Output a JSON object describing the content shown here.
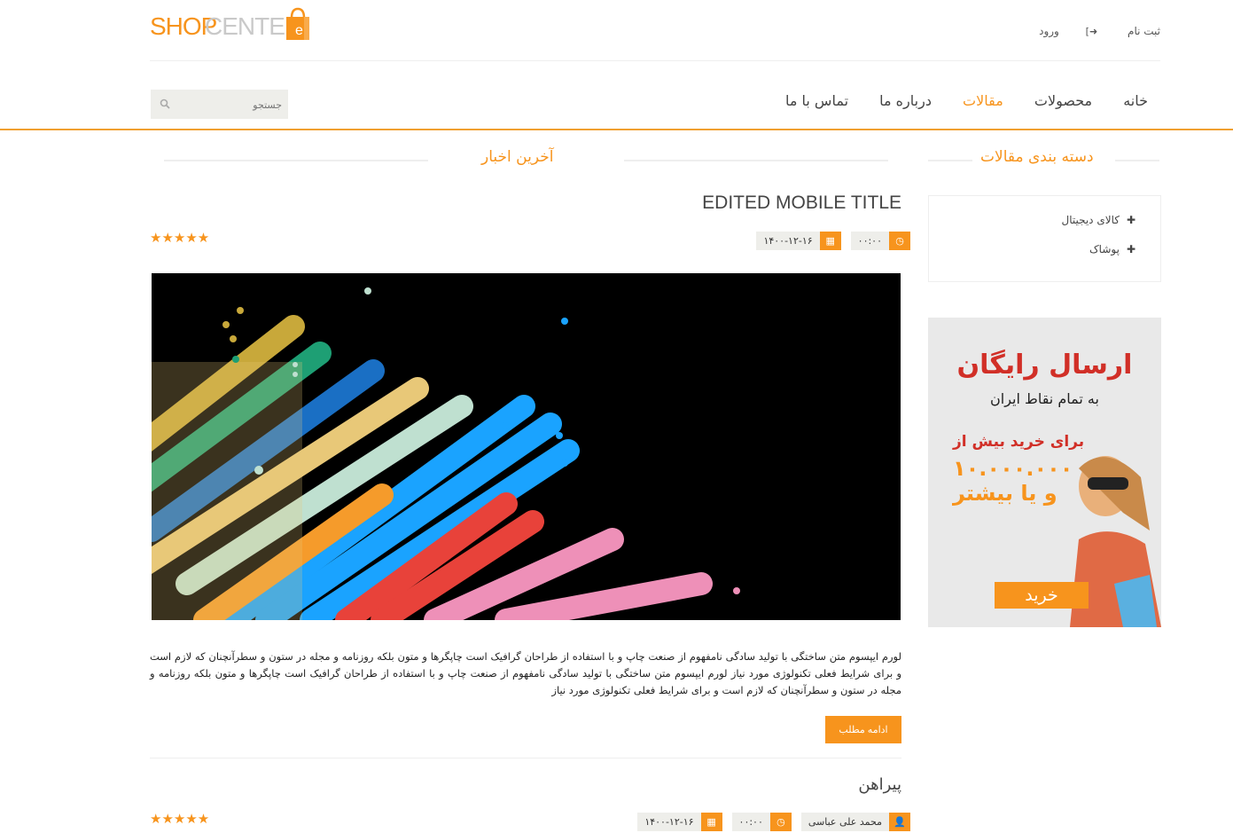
{
  "header": {
    "logo_shop": "SHOP",
    "logo_center": "CENTER",
    "logo_badge": "e",
    "links": {
      "register": "ثبت نام",
      "login": "ورود"
    }
  },
  "nav": {
    "items": [
      "خانه",
      "محصولات",
      "مقالات",
      "درباره ما",
      "تماس با ما"
    ],
    "active": "مقالات",
    "search_placeholder": "جستجو"
  },
  "colors": {
    "accent": "#f7941d",
    "banner_red": "#d12f27"
  },
  "main": {
    "section_title": "آخرین اخبار",
    "posts": [
      {
        "title": "EDITED MOBILE TITLE",
        "time": "۰۰:۰۰",
        "date": "۱۴۰۰-۱۲-۱۶",
        "stars": "★★★★★",
        "rating": 5,
        "image_icon": "abstract-paint-splash-image",
        "excerpt": "لورم ایپسوم متن ساختگی با تولید سادگی نامفهوم از صنعت چاپ و با استفاده از طراحان گرافیک است چاپگرها و متون بلکه روزنامه و مجله در ستون و سطرآنچنان که لازم است و برای شرایط فعلی تکنولوژی مورد نیاز لورم ایپسوم متن ساختگی با تولید سادگی نامفهوم از صنعت چاپ و با استفاده از طراحان گرافیک است چاپگرها و متون بلکه روزنامه و مجله در ستون و سطرآنچنان که لازم است و برای شرایط فعلی تکنولوژی مورد نیاز",
        "more_label": "ادامه مطلب"
      },
      {
        "title": "پیراهن",
        "author": "محمد علی عباسی",
        "time": "۰۰:۰۰",
        "date": "۱۴۰۰-۱۲-۱۶",
        "stars": "★★★★★",
        "rating": 5
      }
    ]
  },
  "sidebar": {
    "section_title": "دسته بندی مقالات",
    "categories": [
      "کالای دیجیتال",
      "پوشاک"
    ],
    "banner": {
      "title": "ارسال رایگان",
      "subtitle": "به تمام نقاط ایران",
      "line1": "برای خرید بیش از",
      "amount": "۱۰.۰۰۰.۰۰۰",
      "line3": "و یا بیشتر",
      "button": "خرید"
    }
  }
}
